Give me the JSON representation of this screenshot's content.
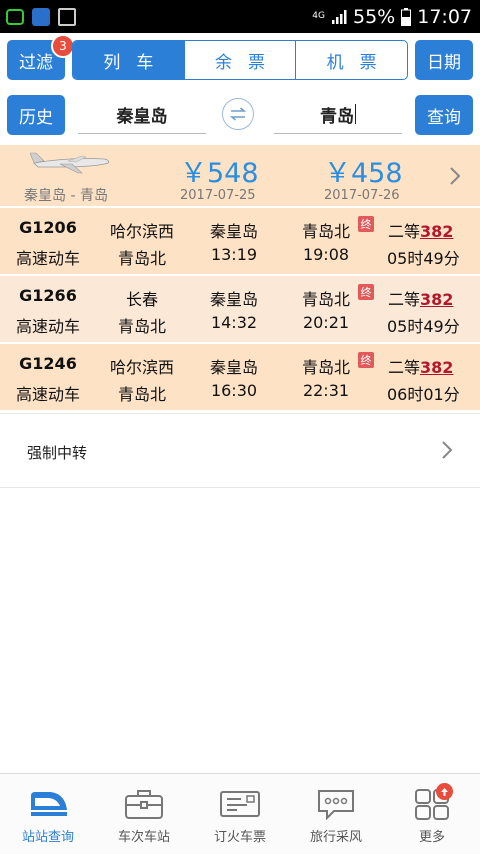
{
  "status_bar": {
    "network": "4G",
    "battery": "55%",
    "time": "17:07"
  },
  "top_row": {
    "filter_label": "过滤",
    "filter_badge": "3",
    "tabs": [
      {
        "label": "列车",
        "active": true
      },
      {
        "label": "余票",
        "active": false
      },
      {
        "label": "机票",
        "active": false
      }
    ],
    "date_label": "日期"
  },
  "search_row": {
    "history_label": "历史",
    "from_station": "秦皇岛",
    "to_station": "青岛",
    "query_label": "查询"
  },
  "flight_banner": {
    "route": "秦皇岛 - 青岛",
    "prices": [
      {
        "price": "￥548",
        "date": "2017-07-25"
      },
      {
        "price": "￥458",
        "date": "2017-07-26"
      }
    ]
  },
  "trains": [
    {
      "code": "G1206",
      "type": "高速动车",
      "origin": "哈尔滨西",
      "terminal": "青岛北",
      "depart_station": "秦皇岛",
      "depart_time": "13:19",
      "arrive_station": "青岛北",
      "arrive_time": "19:08",
      "terminal_badge": "终",
      "seat_class": "二等",
      "seats": "382",
      "duration": "05时49分"
    },
    {
      "code": "G1266",
      "type": "高速动车",
      "origin": "长春",
      "terminal": "青岛北",
      "depart_station": "秦皇岛",
      "depart_time": "14:32",
      "arrive_station": "青岛北",
      "arrive_time": "20:21",
      "terminal_badge": "终",
      "seat_class": "二等",
      "seats": "382",
      "duration": "05时49分"
    },
    {
      "code": "G1246",
      "type": "高速动车",
      "origin": "哈尔滨西",
      "terminal": "青岛北",
      "depart_station": "秦皇岛",
      "depart_time": "16:30",
      "arrive_station": "青岛北",
      "arrive_time": "22:31",
      "terminal_badge": "终",
      "seat_class": "二等",
      "seats": "382",
      "duration": "06时01分"
    }
  ],
  "transfer": {
    "label": "强制中转"
  },
  "bottom_nav": [
    {
      "label": "站站查询",
      "icon": "train-icon",
      "active": true
    },
    {
      "label": "车次车站",
      "icon": "briefcase-icon",
      "active": false
    },
    {
      "label": "订火车票",
      "icon": "ticket-icon",
      "active": false
    },
    {
      "label": "旅行采风",
      "icon": "chat-bubble-icon",
      "active": false
    },
    {
      "label": "更多",
      "icon": "grid-icon",
      "active": false
    }
  ],
  "colors": {
    "accent": "#2c7fd6",
    "row_bg": "#fde2c6",
    "price": "#2a8fe0",
    "seats": "#b2182b",
    "badge": "#e74c3c"
  }
}
